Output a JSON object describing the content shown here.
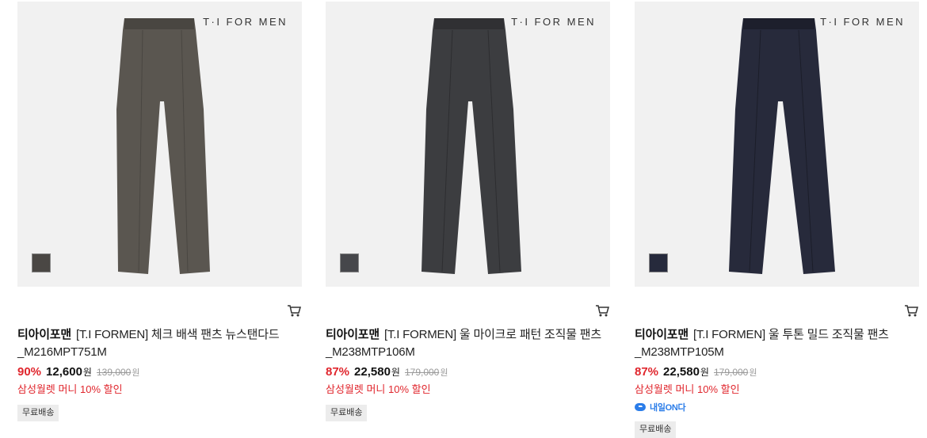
{
  "products": [
    {
      "brand_logo": "T·I FOR MEN",
      "brand_name": "티아이포맨",
      "title": "[T.I FORMEN] 체크 배색 팬츠 뉴스탠다드",
      "title_line2": "_M216MPT751M",
      "discount": "90%",
      "price": "12,600",
      "won": "원",
      "original_price": "139,000",
      "promo": "삼성월렛 머니 10% 할인",
      "tag": "무료배송",
      "pants_color": "#5a5650",
      "swatch_color": "#4a4744"
    },
    {
      "brand_logo": "T·I FOR MEN",
      "brand_name": "티아이포맨",
      "title": "[T.I FORMEN] 울 마이크로 패턴 조직물 팬츠",
      "title_line2": "_M238MTP106M",
      "discount": "87%",
      "price": "22,580",
      "won": "원",
      "original_price": "179,000",
      "promo": "삼성월렛 머니 10% 할인",
      "tag": "무료배송",
      "pants_color": "#3c3d40",
      "swatch_color": "#46474b"
    },
    {
      "brand_logo": "T·I FOR MEN",
      "brand_name": "티아이포맨",
      "title": "[T.I FORMEN] 울 투톤 밀드 조직물 팬츠",
      "title_line2": "_M238MTP105M",
      "discount": "87%",
      "price": "22,580",
      "won": "원",
      "original_price": "179,000",
      "promo": "삼성월렛 머니 10% 할인",
      "delivery_badge": "내일ON다",
      "tag": "무료배송",
      "pants_color": "#272a3b",
      "swatch_color": "#262a3c"
    }
  ]
}
